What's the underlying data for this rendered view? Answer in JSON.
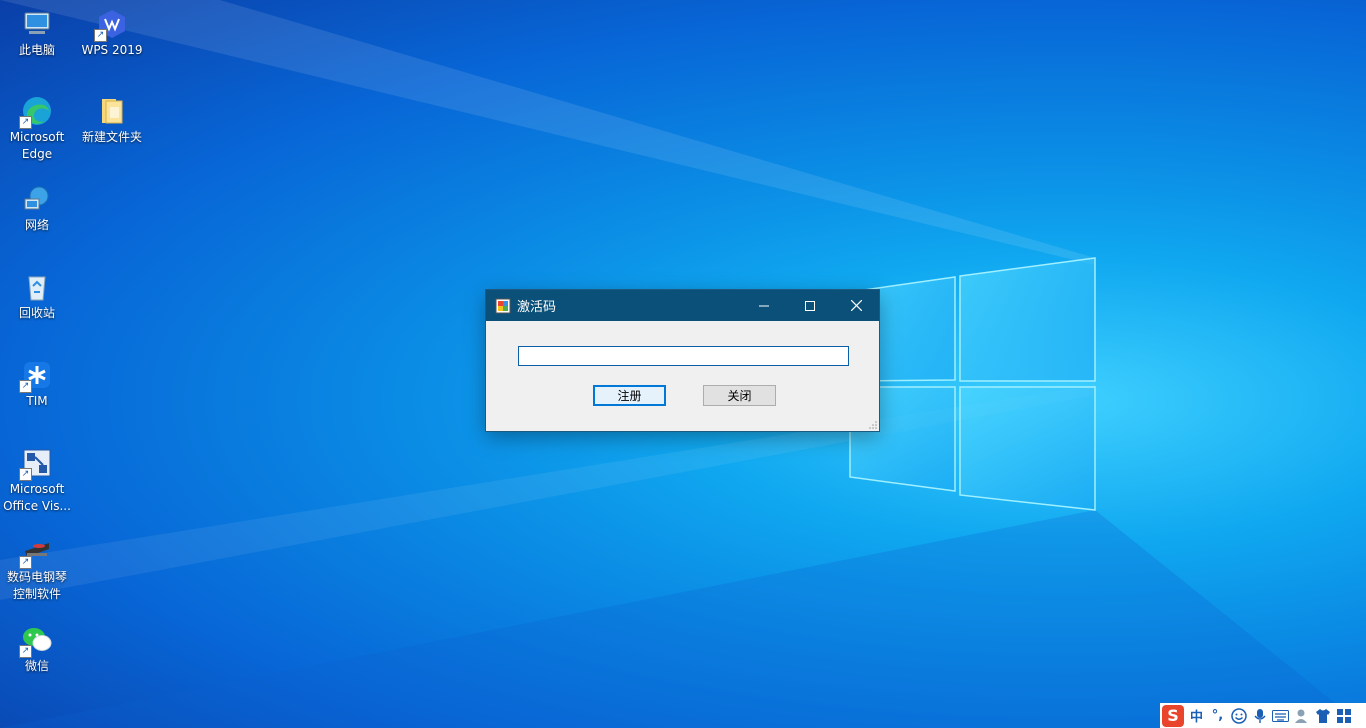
{
  "desktop": {
    "icons": [
      {
        "label_1": "此电脑",
        "label_2": ""
      },
      {
        "label_1": "WPS 2019",
        "label_2": ""
      },
      {
        "label_1": "Microsoft",
        "label_2": "Edge"
      },
      {
        "label_1": "新建文件夹",
        "label_2": ""
      },
      {
        "label_1": "网络",
        "label_2": ""
      },
      {
        "label_1": "回收站",
        "label_2": ""
      },
      {
        "label_1": "TIM",
        "label_2": ""
      },
      {
        "label_1": "Microsoft",
        "label_2": "Office Vis..."
      },
      {
        "label_1": "数码电钢琴",
        "label_2": "控制软件"
      },
      {
        "label_1": "微信",
        "label_2": ""
      }
    ]
  },
  "dialog": {
    "title": "激活码",
    "input_value": "",
    "register_label": "注册",
    "close_label": "关闭"
  },
  "tray": {
    "ime_logo": "S",
    "ime_mode": "中",
    "punct": "°,"
  },
  "colors": {
    "titlebar": "#0b5078",
    "accent": "#0078d7",
    "wallpaper": "#0a8ae4"
  }
}
